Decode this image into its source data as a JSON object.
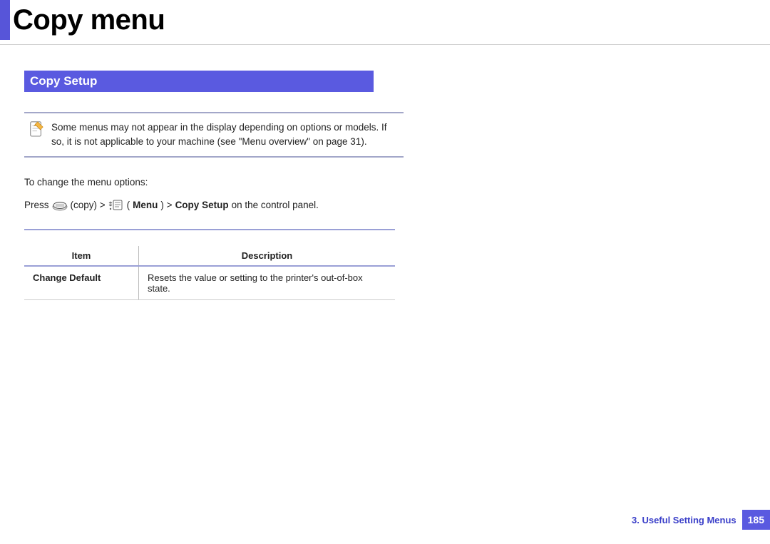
{
  "page_title": "Copy menu",
  "section_title": "Copy Setup",
  "note_text": "Some menus may not appear in the display depending on options or models. If so, it is not applicable to your machine (see \"Menu overview\" on page 31).",
  "instructions": {
    "line1": "To change the menu options:",
    "press": "Press",
    "copy_label": "(copy)  >",
    "menu_paren_open": "(",
    "menu_bold": "Menu",
    "menu_paren_close": ")  >",
    "copy_setup_bold": "Copy Setup",
    "tail": "on the control panel."
  },
  "table": {
    "col_item": "Item",
    "col_desc": "Description",
    "rows": [
      {
        "item": "Change Default",
        "desc": "Resets the value or setting to the printer's out-of-box state."
      }
    ]
  },
  "footer": {
    "chapter": "3.  Useful Setting Menus",
    "page": "185"
  }
}
